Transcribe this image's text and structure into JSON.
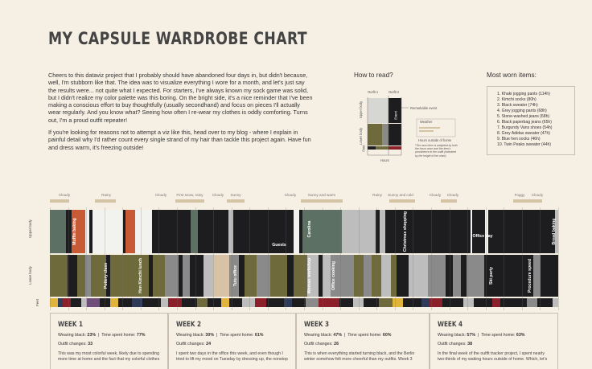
{
  "title": "MY CAPSULE WARDROBE CHART",
  "intro": {
    "p1": "Cheers to this dataviz project that I probably should have abandoned four days in, but didn't because, well, I'm stubborn like that. The idea was to visualize everything I wore for a month, and let's just say the results were... not quite what I expected. For starters, I've always known my sock game was solid, but I didn't realize my color palette was this boring. On the bright side, it's a nice reminder that I've been making a conscious effort to buy thoughtfully (usually secondhand) and focus on pieces I'll actually wear regularly. And you know what? Seeing how often I re-wear my clothes is oddly comforting. Turns out, I'm a proud outfit repeater!",
    "p2": "If you're looking for reasons not to attempt a viz like this, head over to my blog - where I explain in painful detail why I'd rather count every single strand of my hair than tackle this project again. Have fun and dress warm, it's freezing outside!"
  },
  "how_to_read": {
    "title": "How to read?",
    "outfit1": "Outfit 1",
    "outfit2": "Outfit 2",
    "upper": "Upper body",
    "lower": "Lower body",
    "feet": "Feet",
    "remarkable": "Remarkable event",
    "event_label": "Event",
    "weather": "Weather",
    "hours_outside": "Hours outside of home",
    "hours": "Hours",
    "note": "*The worn item is weighted by both the hours worn and the item's prominence in the outfit (indicated by the height of the chart)."
  },
  "most_worn": {
    "title": "Most worn items:",
    "items": [
      "1. Khaki jogging pants (114h)",
      "2. Kimchi socks (80h)",
      "3. Black sweater (74h)",
      "4. Grey jogging pants (68h)",
      "5. Stone-washed jeans (68h)",
      "6. Black paperbag jeans (65h)",
      "7. Burgundy Vans shoes (54h)",
      "8. Grey Adidas sweater (47h)",
      "9. Blue hen socks (46h)",
      "10. Twin Peaks sweater (44h)"
    ]
  },
  "weather": [
    "Cloudy",
    "Rainy",
    "Cloudy",
    "First snow, rainy",
    "Cloudy",
    "Sunny",
    "Cloudy",
    "Sunny and warm",
    "Rainy",
    "Sunny and cold",
    "Cloudy",
    "Cloudy",
    "Foggy",
    "Cloudy"
  ],
  "chart_labels": {
    "upper": "Upper body",
    "lower": "Lower body",
    "feet": "Feet"
  },
  "annotations": [
    "Muffin baking",
    "Guests",
    "Carolina",
    "Christmas shopping",
    "Office day",
    "Bread baking",
    "Pottery class",
    "Hen Kimchi lunch",
    "Tutu office",
    "Woman workshop",
    "Office cooking",
    "Ski party",
    "Procedure speed"
  ],
  "weeks": [
    {
      "title": "WEEK 1",
      "black_label": "Wearing black:",
      "black": "23%",
      "home_label": "Time spent home:",
      "home": "77%",
      "changes_label": "Outfit changes:",
      "changes": "33",
      "desc": "This was my most colorful week, likely due to spending more time at home and the fact that my colorful clothes"
    },
    {
      "title": "WEEK 2",
      "black_label": "Wearing black:",
      "black": "30%",
      "home_label": "Time spent home:",
      "home": "61%",
      "changes_label": "Outfit changes:",
      "changes": "24",
      "desc": "I spent two days in the office this week, and even though I tried to lift my mood on Tuesday by dressing up, the nonstop"
    },
    {
      "title": "WEEK 3",
      "black_label": "Wearing black:",
      "black": "47%",
      "home_label": "Time spent home:",
      "home": "60%",
      "changes_label": "Outfit changes:",
      "changes": "26",
      "desc": "This is when everything started turning black, and the Berlin winter somehow felt more cheerful than my outfits. Week 3"
    },
    {
      "title": "WEEK 4",
      "black_label": "Wearing black:",
      "black": "57%",
      "home_label": "Time spent home:",
      "home": "63%",
      "changes_label": "Outfit changes:",
      "changes": "38",
      "desc": "In the final week of the outfit tracker project, I spent nearly two-thirds of my waking hours outside of home. Which, let's"
    }
  ],
  "chart_data": {
    "type": "table",
    "weeks": [
      {
        "week": "WEEK 1",
        "wearing_black_pct": 23,
        "time_home_pct": 77,
        "outfit_changes": 33
      },
      {
        "week": "WEEK 2",
        "wearing_black_pct": 30,
        "time_home_pct": 61,
        "outfit_changes": 24
      },
      {
        "week": "WEEK 3",
        "wearing_black_pct": 47,
        "time_home_pct": 60,
        "outfit_changes": 26
      },
      {
        "week": "WEEK 4",
        "wearing_black_pct": 57,
        "time_home_pct": 63,
        "outfit_changes": 38
      }
    ],
    "most_worn_hours": [
      {
        "item": "Khaki jogging pants",
        "hours": 114
      },
      {
        "item": "Kimchi socks",
        "hours": 80
      },
      {
        "item": "Black sweater",
        "hours": 74
      },
      {
        "item": "Grey jogging pants",
        "hours": 68
      },
      {
        "item": "Stone-washed jeans",
        "hours": 68
      },
      {
        "item": "Black paperbag jeans",
        "hours": 65
      },
      {
        "item": "Burgundy Vans shoes",
        "hours": 54
      },
      {
        "item": "Grey Adidas sweater",
        "hours": 47
      },
      {
        "item": "Blue hen socks",
        "hours": 46
      },
      {
        "item": "Twin Peaks sweater",
        "hours": 44
      }
    ]
  },
  "colors": {
    "background": "#f6efe4",
    "black": "#1d1c1e",
    "khaki": "#6f6a3c",
    "grey": "#8a8a8a",
    "sage": "#5d7064",
    "rust": "#c95a36",
    "white": "#f2f2ef",
    "cream": "#d7c2a6",
    "lightgrey": "#bdbdbd",
    "navy": "#2e3a57"
  }
}
